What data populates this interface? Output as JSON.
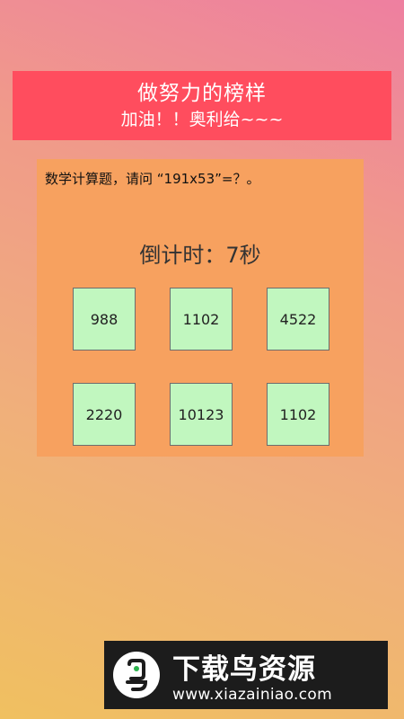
{
  "header": {
    "title": "做努力的榜样",
    "subtitle": "加油！！奥利给~~~"
  },
  "quiz": {
    "question": "数学计算题，请问 “191x53”=？。",
    "timer": "倒计时：7秒",
    "choices": [
      "988",
      "1102",
      "4522",
      "2220",
      "10123",
      "1102"
    ]
  },
  "banner": {
    "brand": "下载鸟资源",
    "url": "www.xiazainiao.com",
    "logo_icon": "bird-logo-icon"
  },
  "colors": {
    "header_bg": "#ff4d5e",
    "panel_bg": "#f7a15f",
    "choice_bg": "#c1f7bf"
  }
}
